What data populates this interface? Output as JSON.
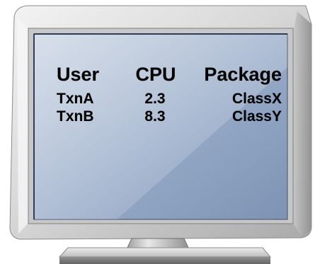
{
  "display": {
    "headers": {
      "user": "User",
      "cpu": "CPU",
      "package": "Package"
    },
    "rows": [
      {
        "user": "TxnA",
        "cpu": "2.3",
        "package": "ClassX"
      },
      {
        "user": "TxnB",
        "cpu": "8.3",
        "package": "ClassY"
      }
    ]
  },
  "colors": {
    "bezel": "#d9d9d9",
    "screen": "#9fb4d1",
    "text": "#000000"
  }
}
